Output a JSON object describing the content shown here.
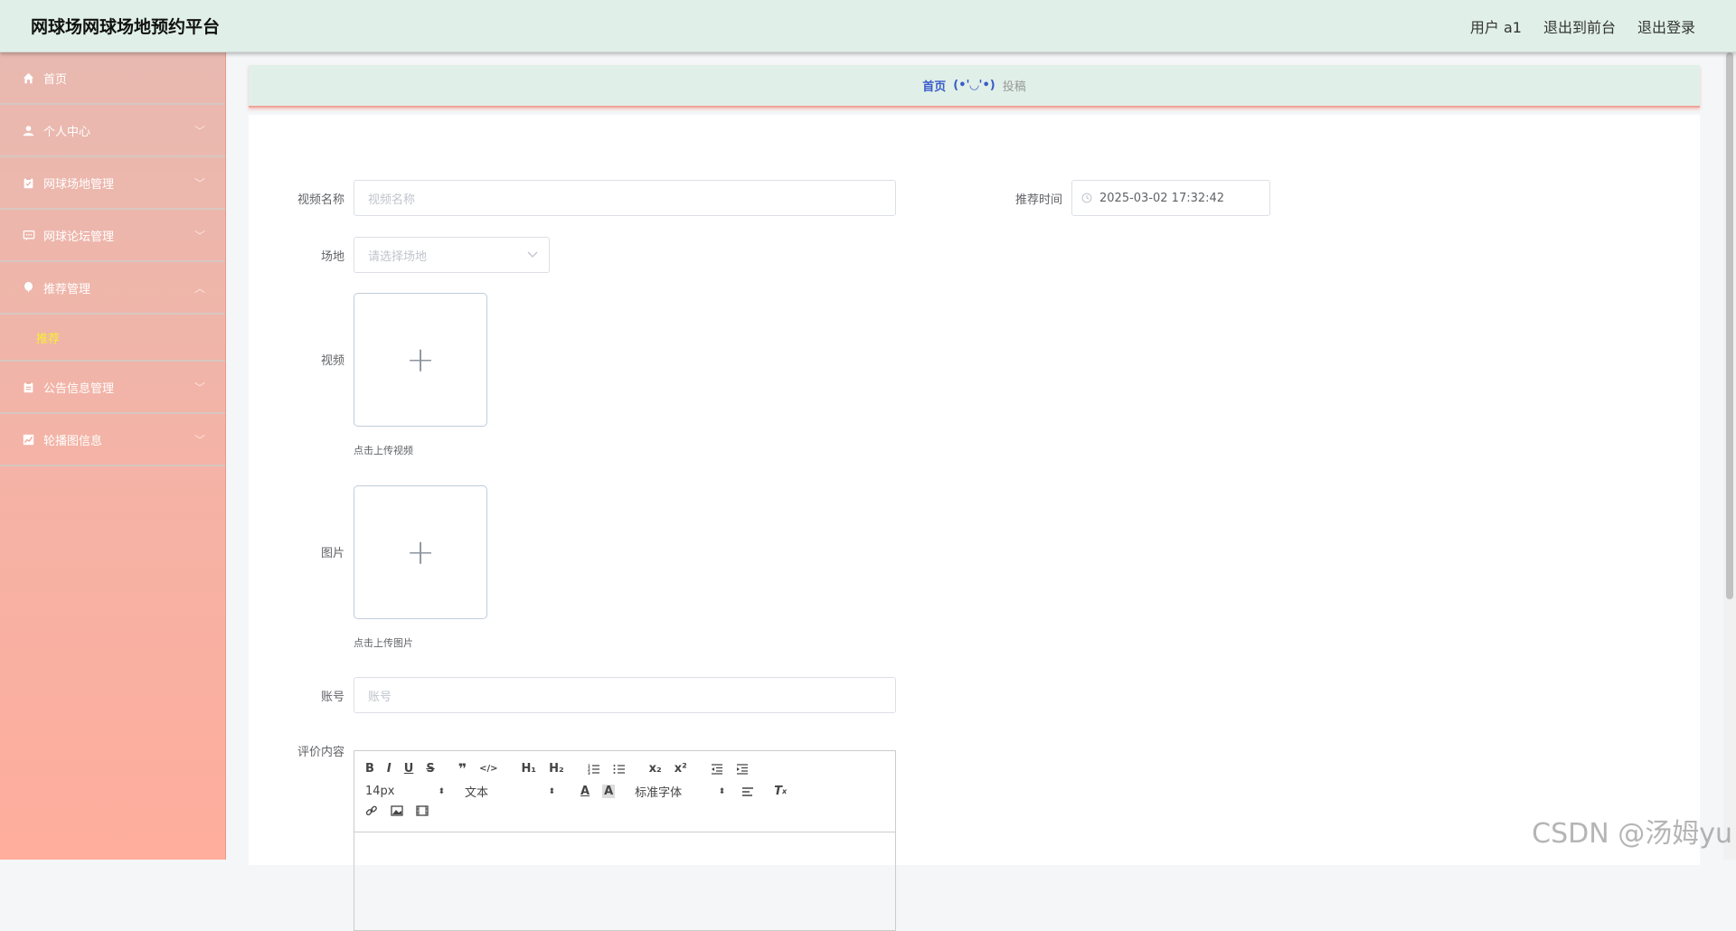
{
  "header": {
    "title": "网球场网球场地预约平台",
    "user": "用户 a1",
    "to_front": "退出到前台",
    "logout": "退出登录"
  },
  "sidebar": {
    "items": [
      {
        "label": "首页",
        "icon": "home-icon",
        "expandable": false
      },
      {
        "label": "个人中心",
        "icon": "user-icon",
        "expandable": true
      },
      {
        "label": "网球场地管理",
        "icon": "clipboard-icon",
        "expandable": true
      },
      {
        "label": "网球论坛管理",
        "icon": "chat-icon",
        "expandable": true
      },
      {
        "label": "推荐管理",
        "icon": "balloon-icon",
        "expandable": true,
        "expanded": true,
        "sub": [
          "推荐"
        ]
      },
      {
        "label": "公告信息管理",
        "icon": "notice-icon",
        "expandable": true
      },
      {
        "label": "轮播图信息",
        "icon": "chart-icon",
        "expandable": true
      }
    ]
  },
  "breadcrumb": {
    "home": "首页",
    "sep": "(•'◡'•)",
    "current": "投稿"
  },
  "form": {
    "video_name_label": "视频名称",
    "video_name_placeholder": "视频名称",
    "recommend_time_label": "推荐时间",
    "recommend_time_value": "2025-03-02 17:32:42",
    "venue_label": "场地",
    "venue_placeholder": "请选择场地",
    "video_label": "视频",
    "video_hint": "点击上传视频",
    "image_label": "图片",
    "image_hint": "点击上传图片",
    "account_label": "账号",
    "account_placeholder": "账号",
    "content_label": "评价内容"
  },
  "editor": {
    "font_size": "14px",
    "block_type": "文本",
    "font_family": "标准字体"
  },
  "watermark": "CSDN @汤姆yu",
  "colors": {
    "header_bg": "#e0f0e8",
    "sidebar_top": "#e8b9b0",
    "sidebar_bottom": "#ffad9c",
    "active_sub": "#f7ef32",
    "breadcrumb_link": "#3a5bc9"
  }
}
